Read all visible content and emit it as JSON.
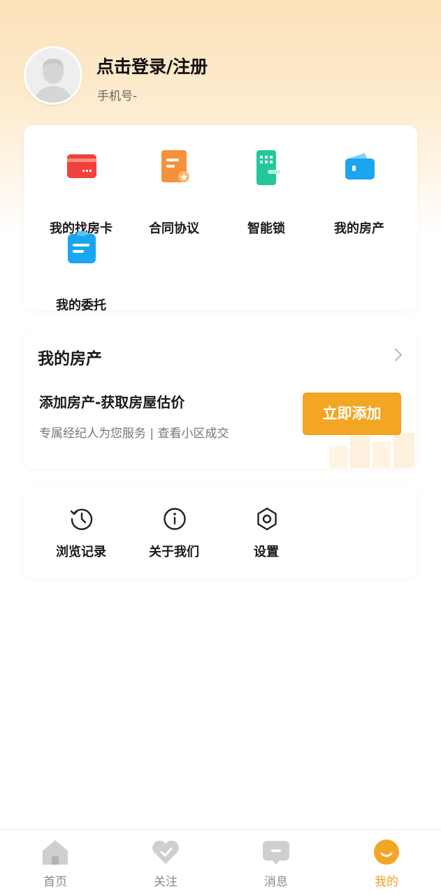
{
  "profile": {
    "login_label": "点击登录/注册",
    "phone_label": "手机号-"
  },
  "services": [
    {
      "label": "我的找房卡",
      "icon": "house-card-icon",
      "color": "#f0413b"
    },
    {
      "label": "合同协议",
      "icon": "contract-icon",
      "color": "#f5913a"
    },
    {
      "label": "智能锁",
      "icon": "smart-lock-icon",
      "color": "#21c99a"
    },
    {
      "label": "我的房产",
      "icon": "property-wallet-icon",
      "color": "#1aa5f0"
    },
    {
      "label": "我的委托",
      "icon": "entrust-clipboard-icon",
      "color": "#1aa5f0"
    }
  ],
  "property": {
    "title": "我的房产",
    "subtitle": "添加房产-获取房屋估价",
    "description": "专属经纪人为您服务 | 查看小区成交",
    "button_label": "立即添加",
    "accent": "#f3a623"
  },
  "tools": [
    {
      "label": "浏览记录",
      "icon": "history-icon"
    },
    {
      "label": "关于我们",
      "icon": "info-icon"
    },
    {
      "label": "设置",
      "icon": "settings-gear-icon"
    }
  ],
  "tabbar": [
    {
      "label": "首页",
      "icon": "home-icon",
      "active": false
    },
    {
      "label": "关注",
      "icon": "heart-icon",
      "active": false
    },
    {
      "label": "消息",
      "icon": "message-icon",
      "active": false
    },
    {
      "label": "我的",
      "icon": "profile-smile-icon",
      "active": true
    }
  ],
  "colors": {
    "active_tab": "#f0a21f",
    "inactive_tab": "#8a8a8a"
  }
}
